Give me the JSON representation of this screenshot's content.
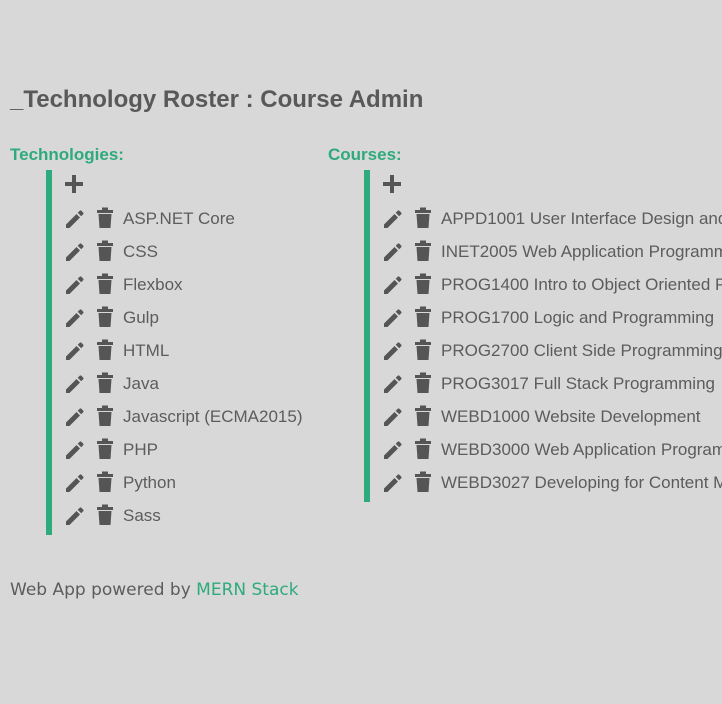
{
  "page_title": "_Technology Roster : Course Admin",
  "technologies": {
    "heading": "Technologies:",
    "items": [
      "ASP.NET Core",
      "CSS",
      "Flexbox",
      "Gulp",
      "HTML",
      "Java",
      "Javascript (ECMA2015)",
      "PHP",
      "Python",
      "Sass"
    ]
  },
  "courses": {
    "heading": "Courses:",
    "items": [
      "APPD1001 User Interface Design and",
      "INET2005 Web Application Programm",
      "PROG1400 Intro to Object Oriented P",
      "PROG1700 Logic and Programming",
      "PROG2700 Client Side Programming",
      "PROG3017 Full Stack Programming",
      "WEBD1000 Website Development",
      "WEBD3000 Web Application Program",
      "WEBD3027 Developing for Content M"
    ]
  },
  "icons": {
    "add": "plus-icon",
    "edit": "pencil-icon",
    "delete": "trash-icon"
  },
  "footer": {
    "prefix": "Web App powered by ",
    "link": "MERN Stack"
  },
  "colors": {
    "accent": "#2eaa7c",
    "background": "#d8d8d8",
    "text": "#5c5c5c"
  }
}
